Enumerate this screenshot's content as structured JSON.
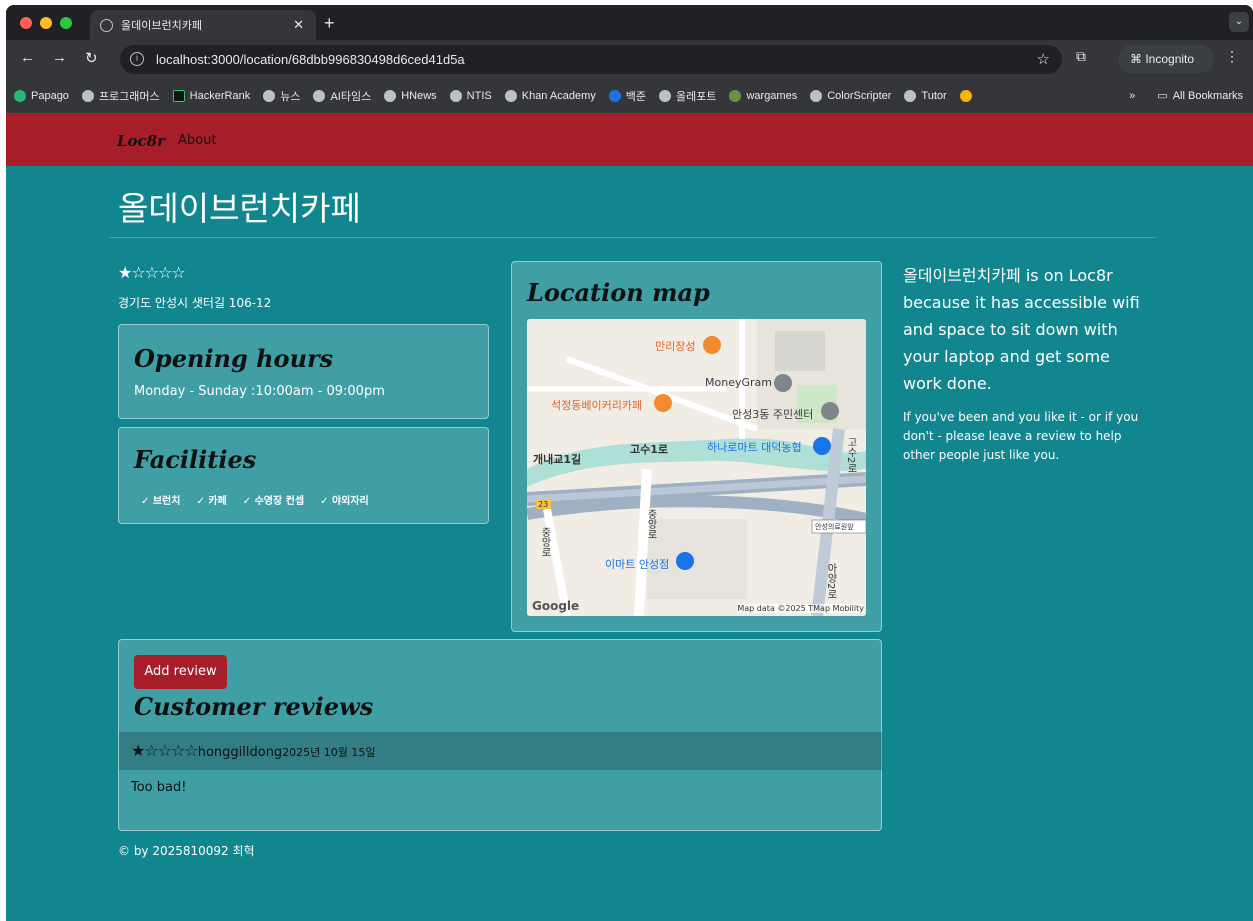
{
  "browser": {
    "tab_title": "올데이브런치카페",
    "url": "localhost:3000/location/68dbb996830498d6ced41d5a",
    "incognito_label": "Incognito",
    "bookmarks": [
      "Papago",
      "프로그래머스",
      "HackerRank",
      "뉴스",
      "AI타임스",
      "HNews",
      "NTIS",
      "Khan Academy",
      "백준",
      "올레포트",
      "wargames",
      "ColorScripter",
      "Tutor"
    ],
    "more_bookmarks": "»",
    "all_bookmarks": "All Bookmarks"
  },
  "nav": {
    "brand": "Loc8r",
    "about": "About"
  },
  "location": {
    "name": "올데이브런치카페",
    "rating_stars": "★☆☆☆☆",
    "address": "경기도 안성시 샛터길 106-12",
    "opening_hours_title": "Opening hours",
    "opening_hours": "Monday - Sunday :10:00am - 09:00pm",
    "facilities_title": "Facilities",
    "facilities": [
      "✓ 브런치",
      "✓ 카페",
      "✓ 수영장 컨셉",
      "✓ 야외자리"
    ],
    "map_title": "Location map",
    "map_labels": {
      "place1": "만리장성",
      "place2": "MoneyGram",
      "place3": "석정동베이커리카페",
      "place4": "안성3동 주민센터",
      "road1": "개내교1길",
      "road2": "고수1로",
      "place5": "하나로마트 대덕농협",
      "road3": "고수2로",
      "route": "23",
      "road4": "중앙로",
      "road5": "중앙로",
      "bus": "안성의료원앞",
      "place6": "이마트 안성점",
      "road6": "아양2로",
      "google": "Google",
      "attribution": "Map data ©2025 TMap Mobility"
    },
    "side_main": "올데이브런치카페 is on Loc8r because it has accessible wifi and space to sit down with your laptop and get some work done.",
    "side_sub": "If you've been and you like it - or if you don't - please leave a review to help other people just like you."
  },
  "reviews": {
    "add_button": "Add review",
    "title": "Customer reviews",
    "items": [
      {
        "stars": "★☆☆☆☆",
        "author": "honggilldong",
        "date": "2025년 10월 15일",
        "text": "Too bad!"
      }
    ]
  },
  "footer": "© by 2025810092 최혁",
  "colors": {
    "page_bg": "#11868f",
    "brand_red": "#a71d2a"
  }
}
